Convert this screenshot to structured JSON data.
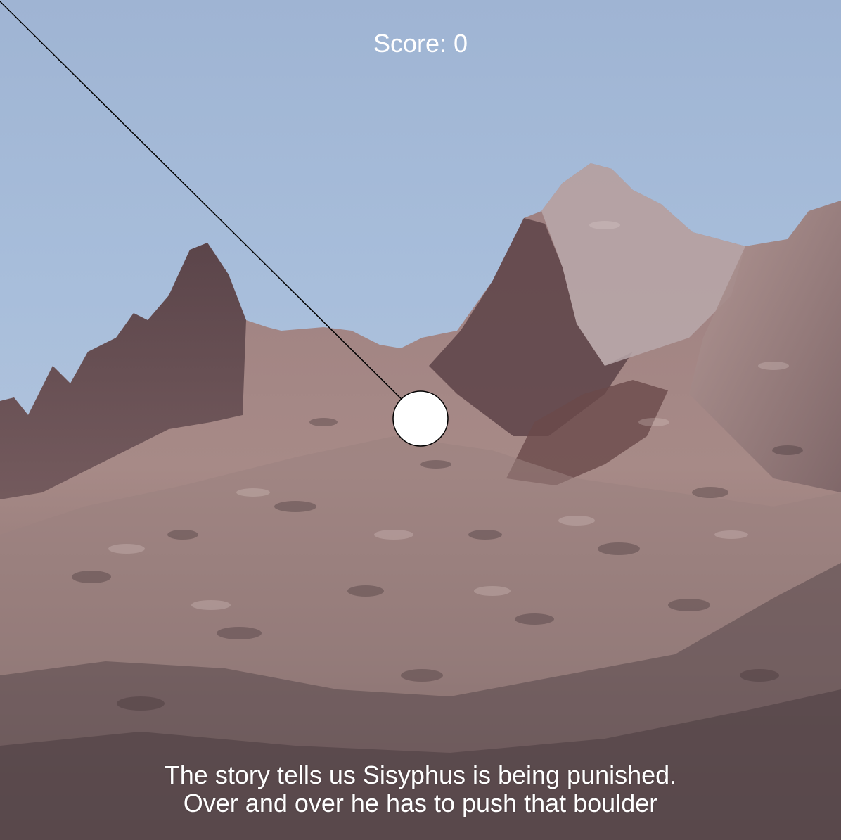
{
  "hud": {
    "score_label": "Score: 0"
  },
  "caption": {
    "line1": "The story tells us Sisyphus is being punished.",
    "line2": "Over and over he has to push that boulder"
  },
  "colors": {
    "sky": "#a8bedb",
    "rock_light": "#b79a95",
    "rock_dark": "#5a4448",
    "boulder_fill": "#ffffff",
    "boulder_stroke": "#000000",
    "text": "#ffffff"
  },
  "scene": {
    "background": "mountain-landscape",
    "boulder": "boulder-circle",
    "aim": "aim-line"
  }
}
